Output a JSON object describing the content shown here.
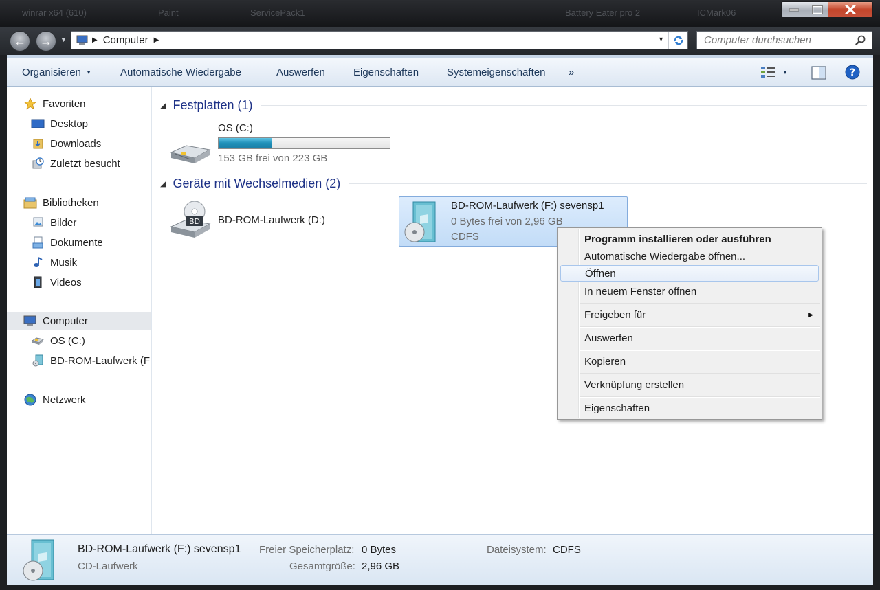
{
  "taskbar_ghost": [
    "winrar x64 (610)",
    "Paint",
    "ServicePack1",
    "Battery Eater pro 2",
    "ICMark06"
  ],
  "window": {
    "address": {
      "segments": [
        "Computer"
      ]
    },
    "search": {
      "placeholder": "Computer durchsuchen"
    }
  },
  "toolbar": {
    "items": [
      "Organisieren",
      "Automatische Wiedergabe",
      "Auswerfen",
      "Eigenschaften",
      "Systemeigenschaften"
    ],
    "more": "»"
  },
  "navpane": {
    "favorites": {
      "label": "Favoriten",
      "items": [
        "Desktop",
        "Downloads",
        "Zuletzt besucht"
      ]
    },
    "libraries": {
      "label": "Bibliotheken",
      "items": [
        "Bilder",
        "Dokumente",
        "Musik",
        "Videos"
      ]
    },
    "computer": {
      "label": "Computer",
      "items": [
        "OS (C:)",
        "BD-ROM-Laufwerk (F:)"
      ]
    },
    "network": {
      "label": "Netzwerk"
    }
  },
  "content": {
    "groups": [
      {
        "title": "Festplatten (1)",
        "drives": [
          {
            "name": "OS (C:)",
            "free": "153 GB frei von 223 GB",
            "usage_fraction": 0.31
          }
        ]
      },
      {
        "title": "Geräte mit Wechselmedien (2)",
        "drives": [
          {
            "name": "BD-ROM-Laufwerk (D:)"
          },
          {
            "name": "BD-ROM-Laufwerk (F:) sevensp1",
            "free": "0 Bytes frei von 2,96 GB",
            "fs": "CDFS"
          }
        ]
      }
    ]
  },
  "context_menu": {
    "items": [
      {
        "label": "Programm installieren oder ausführen"
      },
      {
        "label": "Automatische Wiedergabe öffnen..."
      },
      {
        "label": "Öffnen"
      },
      {
        "label": "In neuem Fenster öffnen"
      },
      {
        "label": "Freigeben für"
      },
      {
        "label": "Auswerfen"
      },
      {
        "label": "Kopieren"
      },
      {
        "label": "Verknüpfung erstellen"
      },
      {
        "label": "Eigenschaften"
      }
    ]
  },
  "details": {
    "name": "BD-ROM-Laufwerk (F:) sevensp1",
    "type": "CD-Laufwerk",
    "free_label": "Freier Speicherplatz:",
    "free_value": "0 Bytes",
    "total_label": "Gesamtgröße:",
    "total_value": "2,96 GB",
    "fs_label": "Dateisystem:",
    "fs_value": "CDFS"
  },
  "colors": {
    "accent": "#1e3287",
    "usage_bar": "#26a0da",
    "selection": "#cde3fa"
  }
}
